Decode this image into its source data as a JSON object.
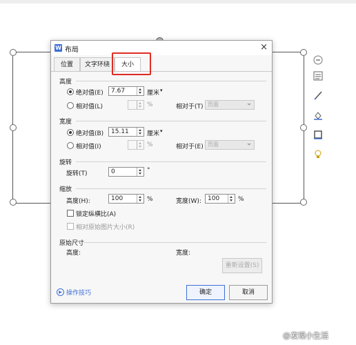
{
  "dialog": {
    "title": "布局",
    "app_icon": "W",
    "close_glyph": "×",
    "tabs": [
      {
        "label": "位置"
      },
      {
        "label": "文字环绕"
      },
      {
        "label": "大小",
        "selected": true
      }
    ],
    "height_section": {
      "title": "高度",
      "absolute_label": "绝对值(E)",
      "absolute_value": "7.67",
      "absolute_unit": "厘米",
      "relative_label": "相对值(L)",
      "relative_unit": "%",
      "relative_to_label": "相对于(T)",
      "relative_to_value": "页面"
    },
    "width_section": {
      "title": "宽度",
      "absolute_label": "绝对值(B)",
      "absolute_value": "15.11",
      "absolute_unit": "厘米",
      "relative_label": "相对值(I)",
      "relative_unit": "%",
      "relative_to_label": "相对于(E)",
      "relative_to_value": "页面"
    },
    "rotate_section": {
      "title": "旋转",
      "label": "旋转(T)",
      "value": "0",
      "unit": "°"
    },
    "scale_section": {
      "title": "缩放",
      "height_label": "高度(H):",
      "height_value": "100",
      "height_unit": "%",
      "width_label": "宽度(W):",
      "width_value": "100",
      "width_unit": "%",
      "lock_aspect_label": "锁定纵横比(A)",
      "relative_original_label": "相对原始图片大小(R)"
    },
    "original_section": {
      "title": "原始尺寸",
      "height_label": "高度:",
      "width_label": "宽度:",
      "reset_label": "重新设置(S)"
    },
    "tips_label": "操作技巧",
    "ok_label": "确定",
    "cancel_label": "取消"
  },
  "side_toolbar": [
    "minus-circle-icon",
    "layout-icon",
    "pen-icon",
    "fill-icon",
    "border-icon",
    "bulb-icon"
  ],
  "watermark": "@发现小生活",
  "colors": {
    "accent": "#3d6fd6",
    "highlight_box": "#e02b22"
  }
}
